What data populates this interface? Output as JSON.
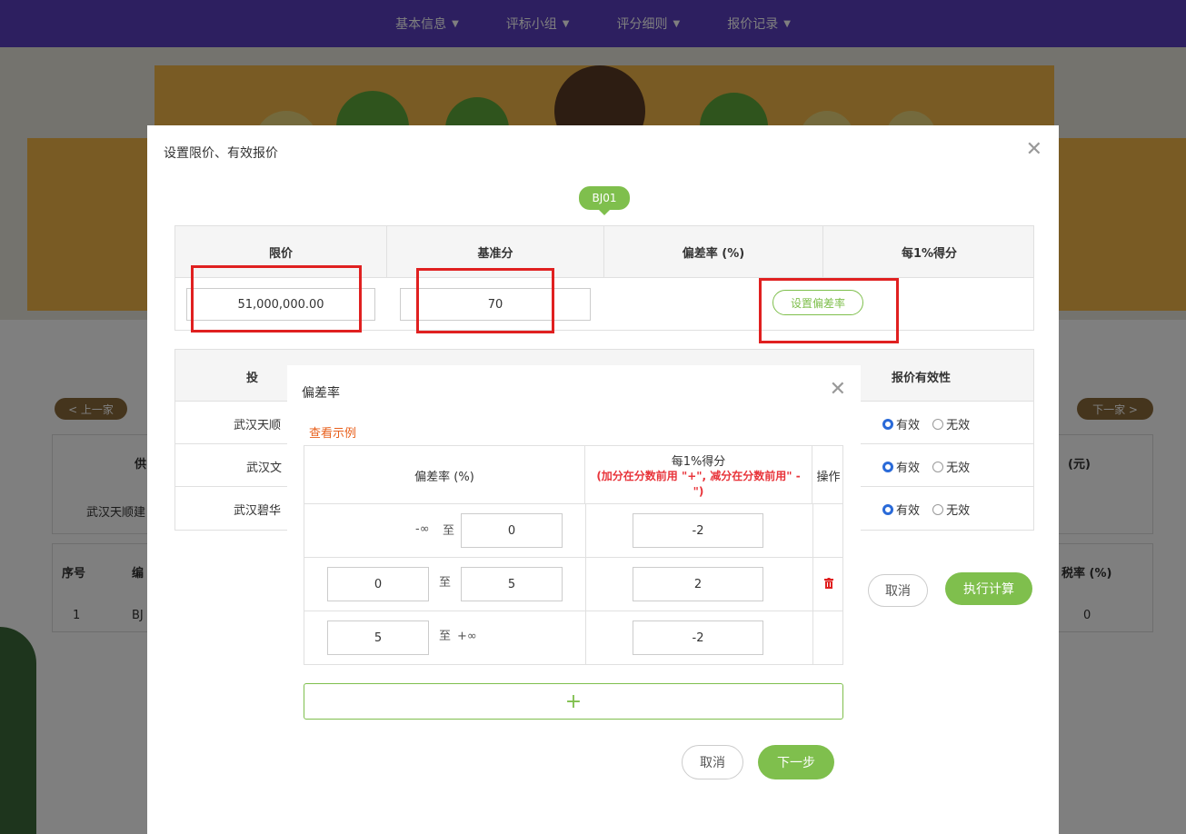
{
  "nav": {
    "items": [
      {
        "label": "基本信息",
        "icon": "chevron-down-icon"
      },
      {
        "label": "评标小组",
        "icon": "chevron-down-icon"
      },
      {
        "label": "评分细则",
        "icon": "chevron-down-icon"
      },
      {
        "label": "报价记录",
        "icon": "chevron-down-icon"
      }
    ]
  },
  "background": {
    "prev_label": "< 上一家",
    "next_label": "下一家 >",
    "supplier_header_partial": "供",
    "amount_header_partial": "(元)",
    "supplier_cell": "武汉天顺建",
    "seq_header": "序号",
    "code_header_partial": "编",
    "tax_header_partial": "税率 (%)",
    "row_seq": "1",
    "row_code_partial": "BJ",
    "row_tax": "0"
  },
  "outer_modal": {
    "title": "设置限价、有效报价",
    "close_icon": "close-icon",
    "tag": "BJ01",
    "limit_table": {
      "headers": [
        "限价",
        "基准分",
        "偏差率 (%)",
        "每1%得分"
      ],
      "limit_price": "51,000,000.00",
      "base_score": "70",
      "set_deviation_label": "设置偏差率"
    },
    "bidder_table": {
      "header_left_partial": "投",
      "header_validity": "报价有效性",
      "rows": [
        {
          "name_partial": "武汉天顺",
          "valid": "有效",
          "invalid": "无效",
          "selected": "valid"
        },
        {
          "name_partial": "武汉文",
          "valid": "有效",
          "invalid": "无效",
          "selected": "valid"
        },
        {
          "name_partial": "武汉碧华",
          "valid": "有效",
          "invalid": "无效",
          "selected": "valid"
        }
      ]
    },
    "cancel_label": "取消",
    "execute_label": "执行计算"
  },
  "inner_modal": {
    "title": "偏差率",
    "close_icon": "close-icon",
    "example_link": "查看示例",
    "headers": {
      "deviation": "偏差率 (%)",
      "score": "每1%得分",
      "score_note": "(加分在分数前用 \"+\", 减分在分数前用\" - \")",
      "action": "操作"
    },
    "rows": [
      {
        "from_label": "-∞",
        "sep": "至",
        "to": "0",
        "score": "-2"
      },
      {
        "from": "0",
        "sep": "至",
        "to": "5",
        "score": "2",
        "action_icon": "trash-icon"
      },
      {
        "from": "5",
        "sep": "至",
        "to_label": "+∞",
        "score": "-2"
      }
    ],
    "add_label": "+",
    "cancel_label": "取消",
    "next_label": "下一步"
  },
  "colors": {
    "nav_bg": "#5a3fc0",
    "accent_green": "#7fbf4d",
    "highlight_red": "#e02020",
    "link_orange": "#e8601c",
    "note_red": "#e8343a",
    "radio_blue": "#2a6ad8"
  }
}
